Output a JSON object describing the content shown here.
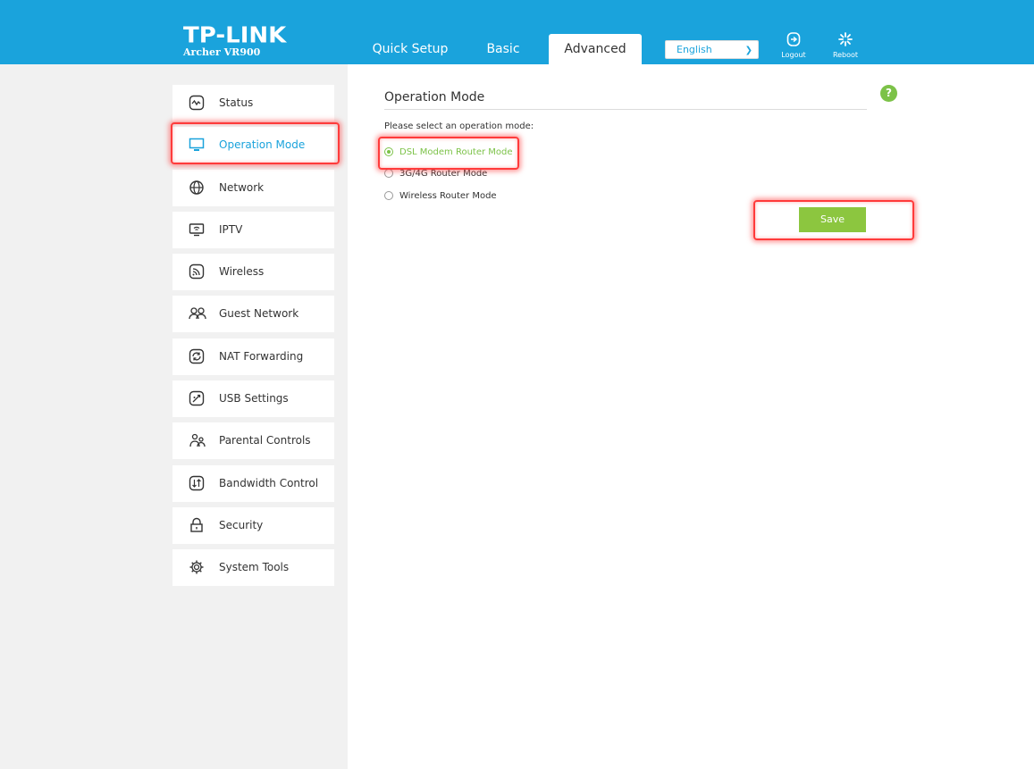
{
  "header": {
    "brand": "TP-LINK",
    "model": "Archer VR900",
    "tabs": [
      {
        "label": "Quick Setup"
      },
      {
        "label": "Basic"
      },
      {
        "label": "Advanced"
      }
    ],
    "language": "English",
    "logout_label": "Logout",
    "reboot_label": "Reboot"
  },
  "sidebar": {
    "items": [
      {
        "label": "Status",
        "icon": "status-icon"
      },
      {
        "label": "Operation Mode",
        "icon": "monitor-icon"
      },
      {
        "label": "Network",
        "icon": "globe-icon"
      },
      {
        "label": "IPTV",
        "icon": "tv-icon"
      },
      {
        "label": "Wireless",
        "icon": "wifi-icon"
      },
      {
        "label": "Guest Network",
        "icon": "guests-icon"
      },
      {
        "label": "NAT Forwarding",
        "icon": "nat-icon"
      },
      {
        "label": "USB Settings",
        "icon": "usb-icon"
      },
      {
        "label": "Parental Controls",
        "icon": "parental-icon"
      },
      {
        "label": "Bandwidth Control",
        "icon": "bandwidth-icon"
      },
      {
        "label": "Security",
        "icon": "lock-icon"
      },
      {
        "label": "System Tools",
        "icon": "gear-icon"
      }
    ],
    "active": "Operation Mode"
  },
  "main": {
    "title": "Operation Mode",
    "prompt": "Please select an operation mode:",
    "options": [
      {
        "label": "DSL Modem Router Mode",
        "checked": true
      },
      {
        "label": "3G/4G Router Mode",
        "checked": false
      },
      {
        "label": "Wireless Router Mode",
        "checked": false
      }
    ],
    "save_label": "Save",
    "help": "?"
  },
  "colors": {
    "header_blue": "#1aa3dc",
    "accent_green": "#7cc248",
    "highlight_red": "#ff3b3b"
  }
}
